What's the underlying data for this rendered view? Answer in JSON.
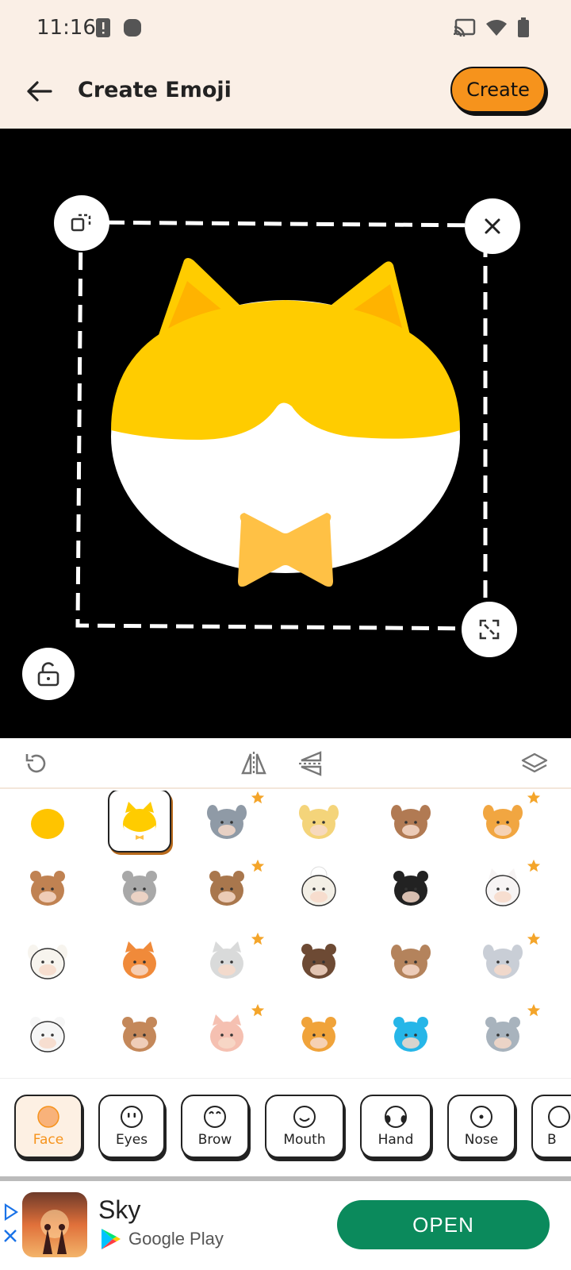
{
  "status_bar": {
    "time": "11:16"
  },
  "app_bar": {
    "title": "Create Emoji",
    "create_label": "Create"
  },
  "canvas": {
    "background": "#000000",
    "sticker": "cat-face-with-bowtie"
  },
  "toolbar": {
    "tools": [
      "undo-icon",
      "flip-horizontal-icon",
      "flip-vertical-icon",
      "layers-icon"
    ]
  },
  "grid": {
    "items": [
      {
        "name": "yellow-circle",
        "premium": false,
        "selected": false
      },
      {
        "name": "yellow-cat",
        "premium": false,
        "selected": true
      },
      {
        "name": "husky",
        "premium": true,
        "selected": false
      },
      {
        "name": "cream-dog",
        "premium": false,
        "selected": false
      },
      {
        "name": "brown-dog",
        "premium": false,
        "selected": false
      },
      {
        "name": "corgi",
        "premium": true,
        "selected": false
      },
      {
        "name": "bear",
        "premium": false,
        "selected": false
      },
      {
        "name": "koala",
        "premium": false,
        "selected": false
      },
      {
        "name": "sloth",
        "premium": true,
        "selected": false
      },
      {
        "name": "sheep",
        "premium": false,
        "selected": false
      },
      {
        "name": "penguin",
        "premium": false,
        "selected": false
      },
      {
        "name": "white-cat-bow",
        "premium": true,
        "selected": false
      },
      {
        "name": "cow",
        "premium": false,
        "selected": false
      },
      {
        "name": "fox",
        "premium": false,
        "selected": false
      },
      {
        "name": "wolf",
        "premium": true,
        "selected": false
      },
      {
        "name": "bison",
        "premium": false,
        "selected": false
      },
      {
        "name": "horse",
        "premium": false,
        "selected": false
      },
      {
        "name": "elephant",
        "premium": true,
        "selected": false
      },
      {
        "name": "polar-bear",
        "premium": false,
        "selected": false
      },
      {
        "name": "monkey",
        "premium": false,
        "selected": false
      },
      {
        "name": "pig",
        "premium": true,
        "selected": false
      },
      {
        "name": "tiger",
        "premium": false,
        "selected": false
      },
      {
        "name": "blue-bird",
        "premium": false,
        "selected": false
      },
      {
        "name": "hippo",
        "premium": true,
        "selected": false
      }
    ]
  },
  "tabs": [
    {
      "label": "Face",
      "icon": "face-icon",
      "active": true
    },
    {
      "label": "Eyes",
      "icon": "eyes-icon",
      "active": false
    },
    {
      "label": "Brow",
      "icon": "brow-icon",
      "active": false
    },
    {
      "label": "Mouth",
      "icon": "mouth-icon",
      "active": false
    },
    {
      "label": "Hand",
      "icon": "hand-icon",
      "active": false
    },
    {
      "label": "Nose",
      "icon": "nose-icon",
      "active": false
    },
    {
      "label": "B",
      "icon": "more-icon",
      "active": false
    }
  ],
  "ad": {
    "app_name": "Sky",
    "store": "Google Play",
    "cta": "OPEN"
  },
  "colors": {
    "accent": "#f6931c",
    "header_bg": "#faefe6",
    "ad_button": "#0b8a5c",
    "cat_yellow": "#ffcc00",
    "bowtie": "#ffc145"
  }
}
